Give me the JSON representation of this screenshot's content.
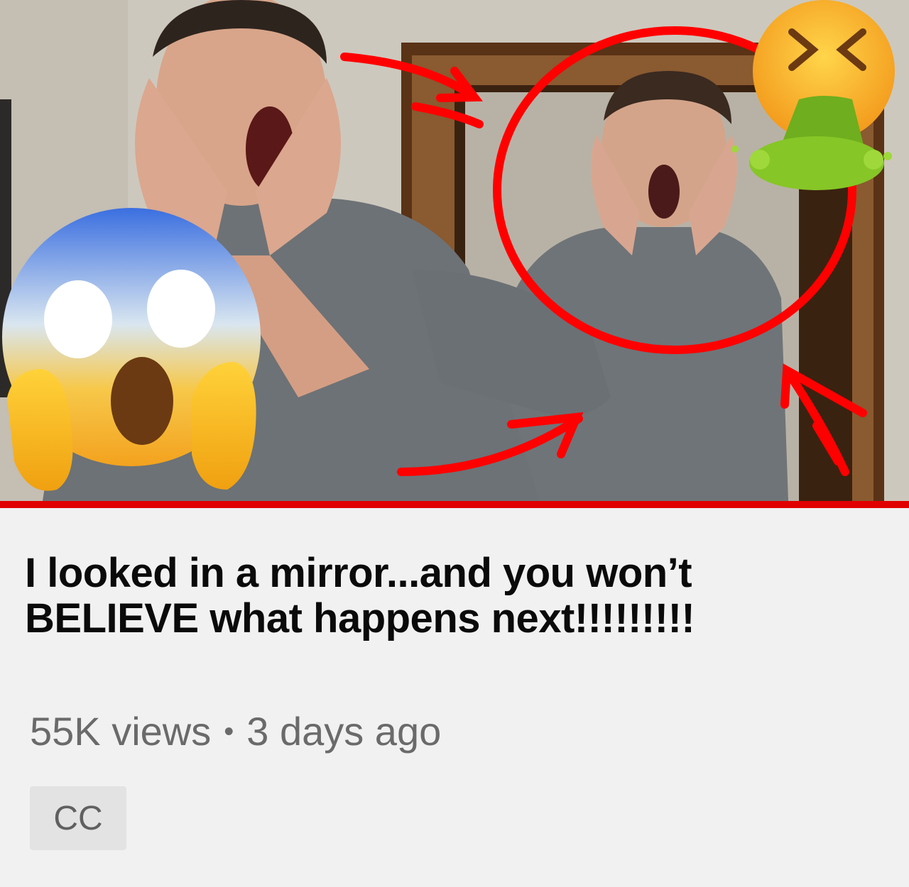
{
  "video": {
    "title_line1": "I looked in a mirror...and you won’t",
    "title_line2": "BELIEVE what happens next!!!!!!!!!",
    "views": "55K views",
    "separator": "•",
    "age": "3 days ago",
    "badge": "CC"
  },
  "thumbnail": {
    "overlays": [
      "face-screaming-in-fear-emoji",
      "face-vomiting-emoji",
      "red-circle-annotation",
      "red-arrow-annotations"
    ]
  },
  "colors": {
    "progress_bar": "#e00000",
    "annotation": "#ff0000",
    "title_text": "#0a0a0a",
    "meta_text": "#6a6a6a",
    "background": "#f1f1f1"
  }
}
